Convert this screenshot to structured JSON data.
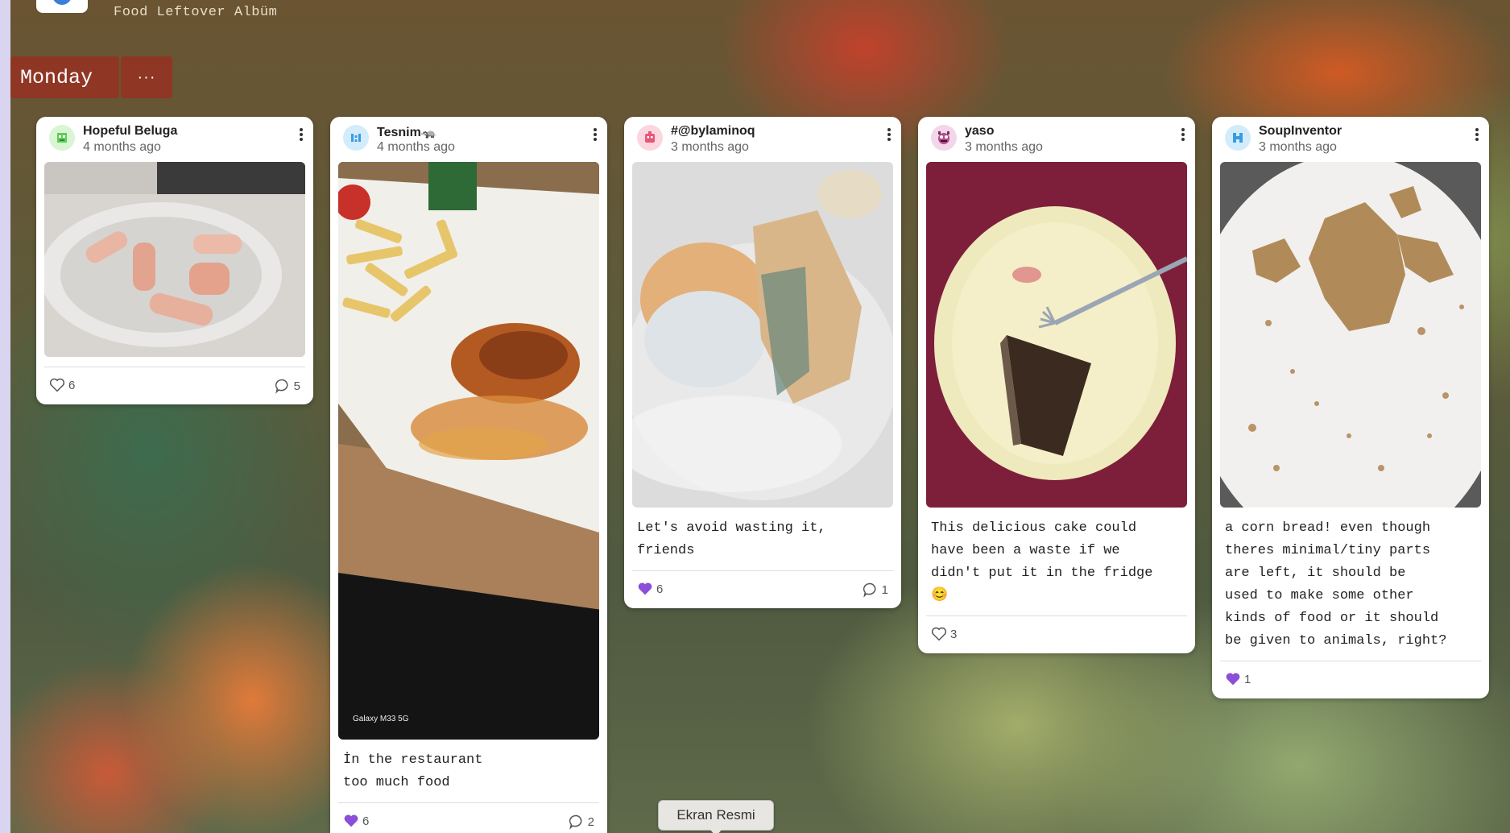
{
  "album": {
    "title": "Food Leftover Albüm"
  },
  "column": {
    "day": "Monday",
    "menu": "···"
  },
  "posts": [
    {
      "user": "Hopeful Beluga",
      "time": "4 months ago",
      "caption": "",
      "likes": "6",
      "comments": "5",
      "liked": false,
      "avatar_color": "#7ed67c",
      "avatar_icon": "alien-icon"
    },
    {
      "user": "Tesnim🦡",
      "time": "4 months ago",
      "caption": "İn the restaurant\ntoo much food",
      "likes": "6",
      "comments": "2",
      "liked": true,
      "avatar_color": "#6db8f0",
      "avatar_icon": "robot-icon",
      "photo_label": "Galaxy M33 5G"
    },
    {
      "user": "#@bylaminoq",
      "time": "3 months ago",
      "caption": "Let's avoid wasting it,\nfriends",
      "likes": "6",
      "comments": "1",
      "liked": true,
      "avatar_color": "#f3a0b4",
      "avatar_icon": "robot-icon"
    },
    {
      "user": "yaso",
      "time": "3 months ago",
      "caption": "This delicious cake could\nhave been a waste if we\ndidn't put it in the fridge\n😊",
      "likes": "3",
      "comments": "",
      "liked": false,
      "avatar_color": "#b34b8c",
      "avatar_icon": "monster-icon"
    },
    {
      "user": "SoupInventor",
      "time": "3 months ago",
      "caption": "a corn bread! even though\ntheres minimal/tiny parts\nare left, it should be\nused to make some other\nkinds of food or it should\nbe given to animals, right?",
      "likes": "1",
      "comments": "",
      "liked": true,
      "avatar_color": "#7cc4ef",
      "avatar_icon": "robot-icon"
    }
  ],
  "colors": {
    "liked": "#8b4fd9",
    "unliked": "#555555",
    "column_header": "#963022"
  },
  "tooltip": {
    "label": "Ekran Resmi"
  }
}
